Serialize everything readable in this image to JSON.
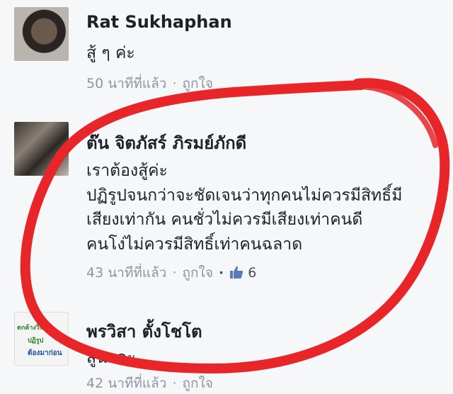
{
  "comments": [
    {
      "name": "Rat Sukhaphan",
      "lines": [
        "สู้ ๆ ค่ะ"
      ],
      "time": "50 นาทีที่แล้ว",
      "like_label": "ถูกใจ"
    },
    {
      "name": "ต๊น จิตภัสร์ ภิรมย์ภักดี",
      "lines": [
        "เราต้องสู้ค่ะ",
        "ปฏิรูปจนกว่าจะชัดเจนว่าทุกคนไม่ควรมีสิทธิ์มี",
        "เสียงเท่ากัน คนชั่วไม่ควรมีเสียงเท่าคนดี",
        "คนโง่ไม่ควรมีสิทธิ์เท่าคนฉลาด"
      ],
      "time": "43 นาทีที่แล้ว",
      "like_label": "ถูกใจ",
      "like_count": "6"
    },
    {
      "name": "พรวิสา ตั้งโชโต",
      "lines": [
        "สู้นะคะ"
      ],
      "time": "42 นาทีที่แล้ว",
      "like_label": "ถูกใจ"
    }
  ],
  "avatar3_text": [
    "ตกค้างวิน",
    "ปฏิรูป",
    "ต้องมาก่อน"
  ],
  "colors": {
    "background": "#f6f7f9",
    "name": "#1d2129",
    "meta": "#90949c",
    "annotation": "#e8262a",
    "thumb": "#5b7bb6"
  }
}
